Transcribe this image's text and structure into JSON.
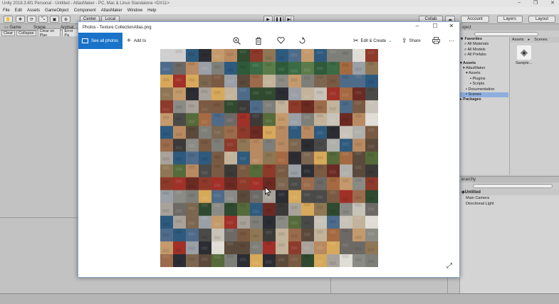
{
  "unity": {
    "window_title": "Unity 2018.3.6f1 Personal - Untitled - AtlasMaker - PC, Mac & Linux Standalone <DX11>",
    "menu": [
      "File",
      "Edit",
      "Assets",
      "GameObject",
      "Component",
      "AtlasMaker",
      "Window",
      "Help"
    ],
    "toolbar": {
      "center_label": "Center",
      "local_label": "Local",
      "collab_label": "Collab",
      "account_label": "Account",
      "layers_label": "Layers",
      "layout_label": "Layout"
    },
    "tabs": {
      "game": "Game",
      "scene": "Scene",
      "animator": "Animat"
    },
    "console": [
      "Clear",
      "Collapse",
      "Clear on Play",
      "Error Pa"
    ],
    "project": {
      "title": "oject",
      "favorites": "Favorites",
      "fav_items": [
        "All Materials",
        "All Models",
        "All Prefabs"
      ],
      "assets": "Assets",
      "asset_items": [
        "AtlasMaker",
        "Assets",
        "Plugins",
        "Scripts",
        "Documentation",
        "Scenes"
      ],
      "packages": "Packages",
      "breadcrumb": [
        "Assets",
        "Scenes"
      ],
      "sample_item": "Sample..."
    },
    "hierarchy": {
      "title": "erarchy",
      "scene": "Untitled",
      "objects": [
        "Main Camera",
        "Directional Light"
      ]
    }
  },
  "photos": {
    "title": "Photos - Texture CollectionAtlas.png",
    "see_all_label": "See all photos",
    "add_to_label": "Add to",
    "edit_create_label": "Edit & Create",
    "share_label": "Share",
    "more_label": "···",
    "icons": [
      "zoom-in-icon",
      "delete-icon",
      "heart-icon",
      "rotate-icon",
      "print-icon",
      "expand-icon"
    ]
  },
  "atlas": {
    "grid_cols": 17,
    "grid_rows": 17,
    "palette": [
      "#7a5a42",
      "#9c6b4b",
      "#b98a61",
      "#6d6a66",
      "#8b8b86",
      "#a8a29a",
      "#5b4a3b",
      "#c49a6c",
      "#3c3a38",
      "#7f7f79",
      "#a56a42",
      "#4e6b8a",
      "#2e5a7e",
      "#8e3a2a",
      "#6b2a22",
      "#c2b39a",
      "#d7a95a",
      "#556b3a",
      "#2f4a2f",
      "#9aa0a6",
      "#4a4a48",
      "#b0b0ab",
      "#7c6650",
      "#c8c3b8",
      "#2b2d33",
      "#e0ddd6",
      "#8f7755",
      "#a03028"
    ],
    "blank_rows": 1
  }
}
